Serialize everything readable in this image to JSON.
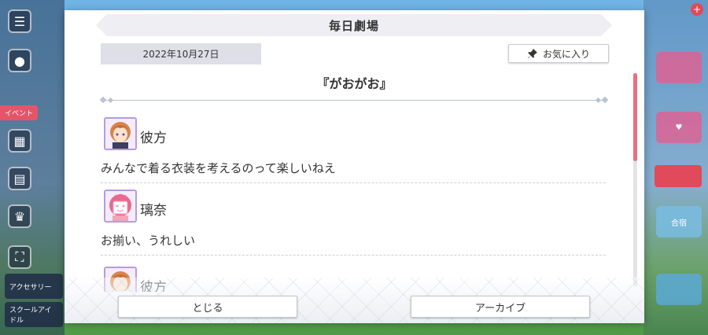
{
  "dialog": {
    "title": "毎日劇場",
    "date": "2022年10月27日",
    "favorite_label": "お気に入り",
    "episode_title": "『がおがお』",
    "entries": [
      {
        "speaker": "彼方",
        "line": "みんなで着る衣装を考えるのって楽しいねえ",
        "avatar": "kanata-avatar"
      },
      {
        "speaker": "璃奈",
        "line": "お揃い、うれしい",
        "avatar": "rina-avatar"
      },
      {
        "speaker": "彼方",
        "line": "",
        "avatar": "kanata-avatar"
      }
    ],
    "close_label": "とじる",
    "archive_label": "アーカイブ"
  },
  "background": {
    "event_label": "イベント",
    "bottom_buttons": [
      "アクセサリー",
      "スクールアイドル"
    ],
    "right_label": "合宿"
  },
  "colors": {
    "accent_pink": "#e8717f",
    "avatar_border": "#b99ae0",
    "banner": "#eeeef3"
  }
}
